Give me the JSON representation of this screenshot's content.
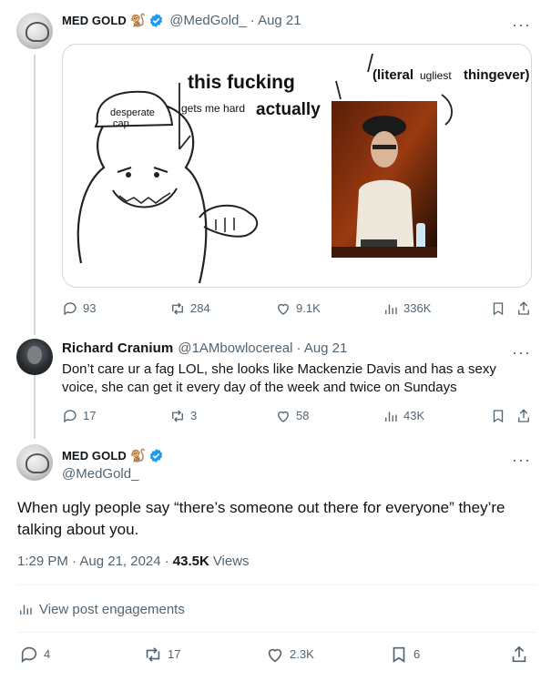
{
  "tweet1": {
    "name": "MED GOLD",
    "handle": "@MedGold_",
    "date": "· Aug 21",
    "emoji": "🐒",
    "meme": {
      "cap_text": "desperate\ncap",
      "bubble1_line1": "this fucking",
      "bubble1_line2a": "gets me hard",
      "bubble1_line2b": "actually",
      "bubble2_part1": "(literal",
      "bubble2_part2": "ugliest",
      "bubble2_part3": "thingever)"
    },
    "stats": {
      "replies": "93",
      "reposts": "284",
      "likes": "9.1K",
      "views": "336K"
    }
  },
  "reply": {
    "name": "Richard Cranium",
    "handle": "@1AMbowlocereal",
    "date": "· Aug 21",
    "text_line1": "Don’t care ur a fag LOL, she looks like Mackenzie Davis and has a sexy",
    "text_line2": "voice, she can get it every day of the week and twice on Sundays",
    "stats": {
      "replies": "17",
      "reposts": "3",
      "likes": "58",
      "views": "43K"
    }
  },
  "main": {
    "name": "MED GOLD",
    "handle": "@MedGold_",
    "emoji": "🐒",
    "text_line1": "When ugly people say “there’s someone out there for everyone” they’re",
    "text_line2": "talking about you.",
    "time": "1:29 PM · Aug 21, 2024 ·",
    "views_count": "43.5K",
    "views_label": "Views",
    "engagements_label": "View post engagements",
    "stats": {
      "replies": "4",
      "reposts": "17",
      "likes": "2.3K",
      "bookmarks": "6"
    }
  },
  "colors": {
    "accent": "#1d9bf0",
    "muted": "#536471",
    "border": "#cfd9de"
  }
}
